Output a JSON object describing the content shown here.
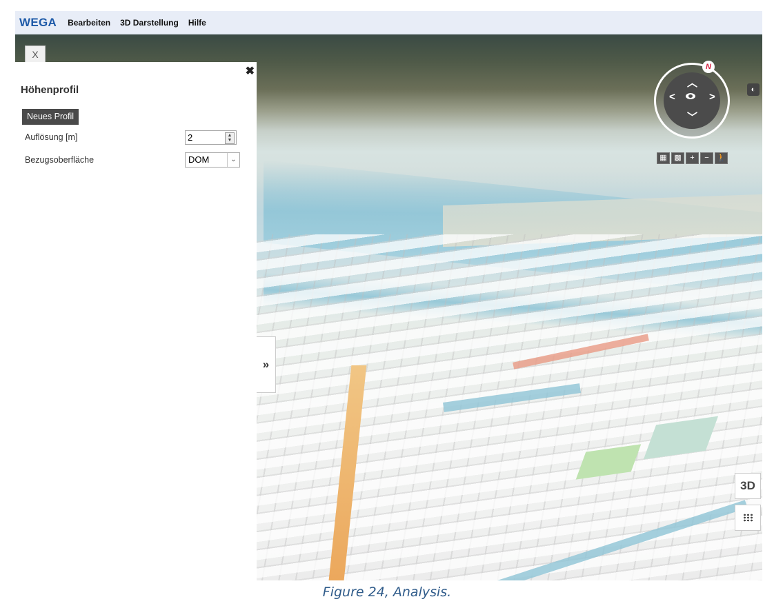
{
  "menubar": {
    "logo": "WEGA",
    "items": [
      "Bearbeiten",
      "3D Darstellung",
      "Hilfe"
    ]
  },
  "tab": {
    "close_label": "X"
  },
  "panel": {
    "close_icon": "✖",
    "title": "Höhenprofil",
    "new_profile_button": "Neues Profil",
    "resolution_label": "Auflösung [m]",
    "resolution_value": "2",
    "surface_label": "Bezugsoberfläche",
    "surface_value": "DOM"
  },
  "expand_handle": "»",
  "compass": {
    "north": "N",
    "icons": [
      "chevron-up-icon",
      "chevron-left-icon",
      "eye-icon",
      "chevron-right-icon",
      "chevron-down-icon"
    ]
  },
  "toolbar_icons": [
    "buildings-icon",
    "grid-icon",
    "zoom-in-icon",
    "zoom-out-icon",
    "pedestrian-icon"
  ],
  "toolbar_glyphs": [
    "▦",
    "▩",
    "+",
    "−",
    "🚶"
  ],
  "contrast_glyph": "◐",
  "view_button": "3D",
  "caption": "Figure 24, Analysis."
}
